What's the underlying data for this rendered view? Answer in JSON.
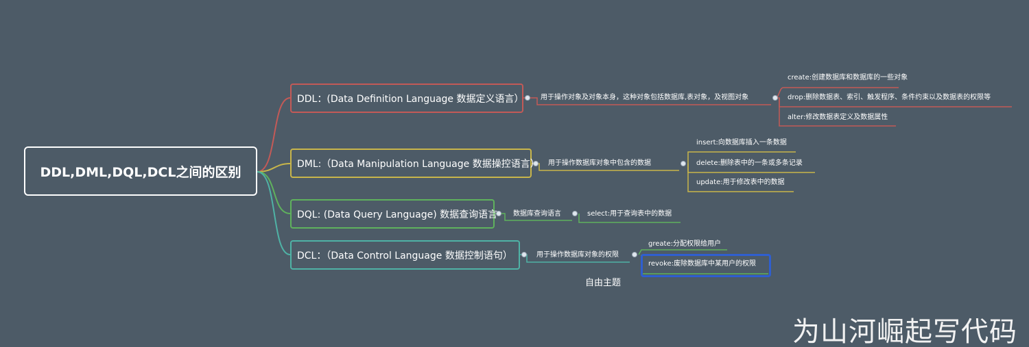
{
  "root": {
    "label": "DDL,DML,DQL,DCL之间的区别"
  },
  "branches": {
    "ddl": {
      "label": "DDL：(Data Definition Language 数据定义语言）",
      "desc": "用于操作对象及对象本身，这种对象包括数据库,表对象，及视图对象",
      "children": [
        "create:创建数据库和数据库的一些对象",
        "drop:删除数据表、索引、触发程序、条件约束以及数据表的权限等",
        "alter:修改数据表定义及数据属性"
      ]
    },
    "dml": {
      "label": "DML:（Data Manipulation Language 数据操控语言）",
      "desc": "用于操作数据库对象中包含的数据",
      "children": [
        "insert:向数据库插入一条数据",
        "delete:删除表中的一条或多条记录",
        "update:用于修改表中的数据"
      ]
    },
    "dql": {
      "label": "DQL: (Data Query Language) 数据查询语言",
      "desc": "数据库查询语言",
      "children": [
        "select:用于查询表中的数据"
      ]
    },
    "dcl": {
      "label": "DCL：（Data Control Language 数据控制语句）",
      "desc": "用于操作数据库对象的权限",
      "children": [
        "greate:分配权限给用户",
        "revoke:废除数据库中某用户的权限"
      ]
    }
  },
  "free_topic": "自由主题",
  "watermark": "为山河崛起写代码",
  "colors": {
    "background": "#4d5b67",
    "ddl": "#c45a57",
    "dml": "#c9b64a",
    "dql": "#5fb25d",
    "dcl": "#4fb3a6",
    "selection": "#2f5fd0"
  }
}
